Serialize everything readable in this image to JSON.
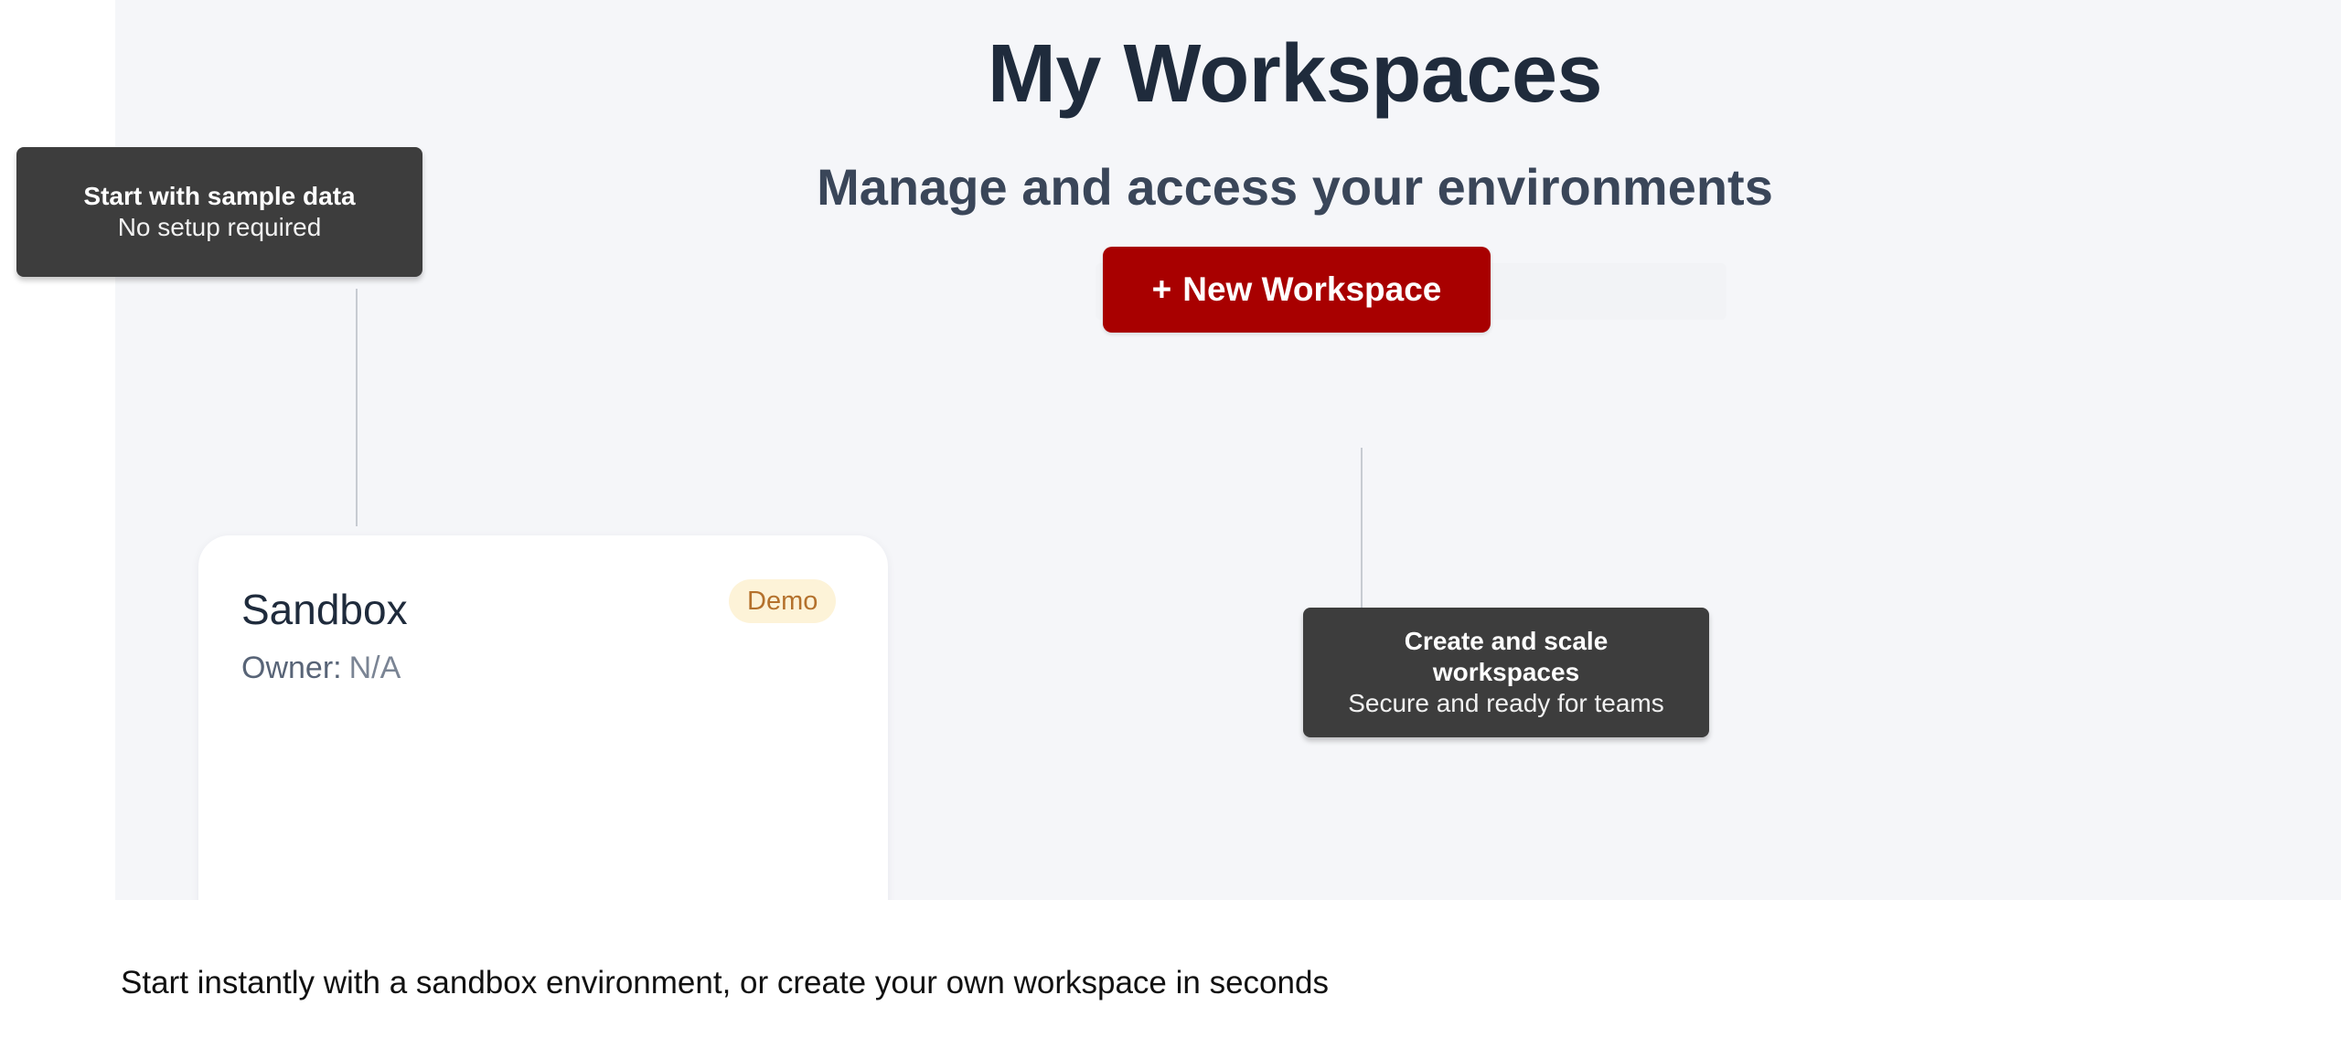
{
  "header": {
    "title": "My Workspaces",
    "subtitle": "Manage and access your environments"
  },
  "actions": {
    "new_workspace_plus": "+",
    "new_workspace_label": "New Workspace",
    "new_workspace_color": "#a80000"
  },
  "workspace_card": {
    "name": "Sandbox",
    "owner_label": "Owner:",
    "owner_value": "N/A",
    "badge": "Demo"
  },
  "callouts": {
    "sample_data": {
      "heading": "Start with sample data",
      "detail": "No setup required"
    },
    "create_scale": {
      "heading": "Create and scale workspaces",
      "detail": "Secure and ready for teams"
    }
  },
  "caption": "Start instantly with a sandbox environment, or create your own workspace in seconds",
  "colors": {
    "panel_background": "#f5f6f9",
    "title_text": "#1f2b3c",
    "callout_background": "#3d3d3d",
    "badge_background": "#fdf3d8",
    "badge_text": "#b4712c"
  }
}
